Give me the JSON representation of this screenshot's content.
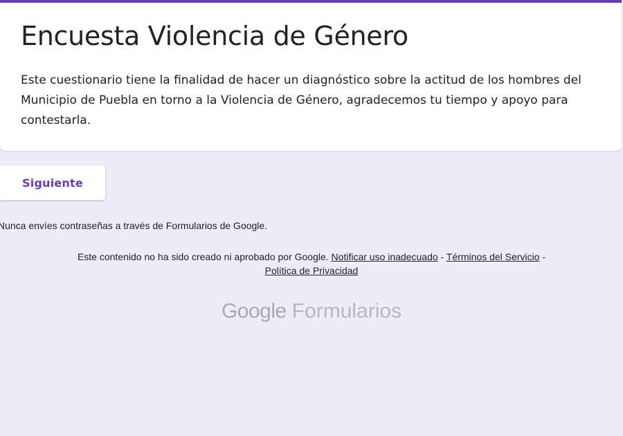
{
  "form": {
    "title": "Encuesta Violencia de Género",
    "description": "Este cuestionario tiene la finalidad de hacer un diagnóstico sobre la actitud de los hombres del Municipio de Puebla en torno a la Violencia de Género, agradecemos tu tiempo y apoyo para contestarla."
  },
  "actions": {
    "next_label": "Siguiente"
  },
  "notices": {
    "password_warning": "Nunca envíes contraseñas a través de Formularios de Google."
  },
  "footer": {
    "disclaimer": "Este contenido no ha sido creado ni aprobado por Google.",
    "report_link": "Notificar uso inadecuado",
    "separator": "-",
    "terms_link": "Términos del Servicio",
    "privacy_link": "Política de Privacidad"
  },
  "brand": {
    "google": "Google",
    "product": "Formularios"
  },
  "colors": {
    "accent": "#673ab7",
    "background": "#f0ebf8",
    "text": "#202124",
    "logo": "#aaaaaa"
  }
}
